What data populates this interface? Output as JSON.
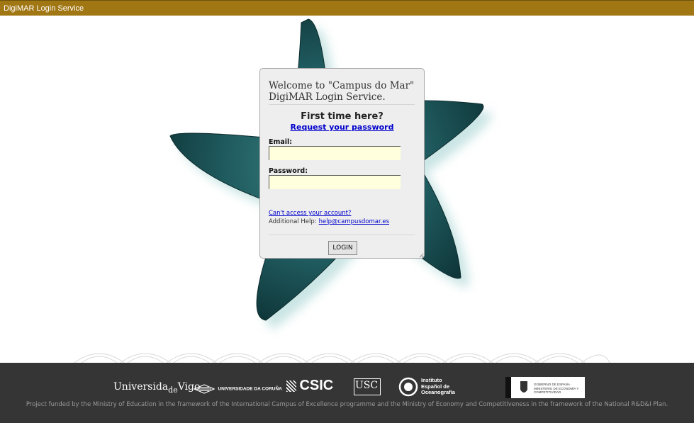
{
  "window": {
    "title": "DigiMAR Login Service"
  },
  "login": {
    "welcome": "Welcome to \"Campus do Mar\" DigiMAR Login Service.",
    "first_time": "First time here?",
    "request_password": "Request your password",
    "email_label": "Email:",
    "email_value": "",
    "password_label": "Password:",
    "password_value": "",
    "cant_access": "Can't access your account?",
    "help_label": "Additional Help:",
    "help_email": "help@campusdomar.es",
    "login_button": "LOGIN"
  },
  "footer": {
    "logos": {
      "vigo_a": "Universida",
      "vigo_b": "de",
      "vigo_c": "Vigo",
      "coruna": "UNIVERSIDADE DA CORUÑA",
      "csic": "CSIC",
      "usc": "USC",
      "ieo": "Instituto Español de Oceanografía",
      "ministry": "GOBIERNO DE ESPAÑA · MINISTERIO DE ECONOMÍA Y COMPETITIVIDAD"
    },
    "funding_text": "Project funded by the Ministry of Education in the framework of the International Campus of Excellence programme and the Ministry of Economy and Competitiveness in the framework of the National R&D&I Plan."
  },
  "colors": {
    "topbar": "#a17714",
    "footer": "#353535",
    "input_bg": "#ffffdd",
    "link": "#0000cc",
    "starfish": "#1f5a5e"
  }
}
